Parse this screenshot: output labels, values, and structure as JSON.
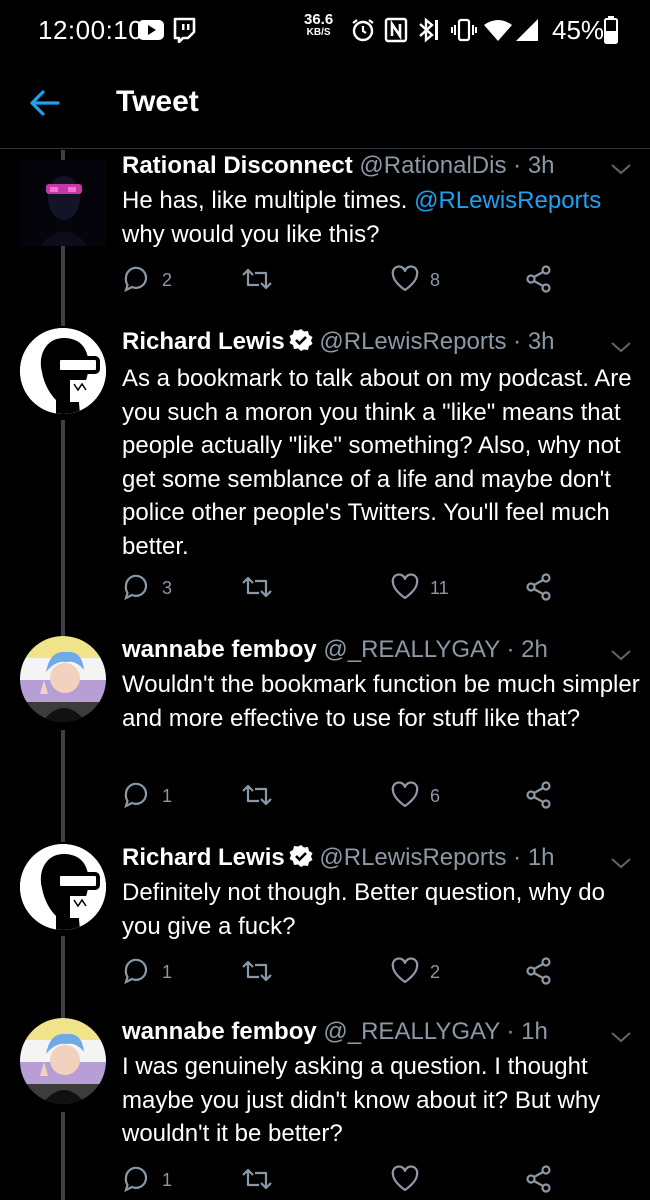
{
  "status_bar": {
    "time": "12:00:10",
    "net_speed": "36.6",
    "net_unit": "KB/S",
    "battery": "45%",
    "icons": [
      "youtube-icon",
      "twitch-icon",
      "alarm-icon",
      "nfc-icon",
      "bluetooth-icon",
      "vibrate-icon",
      "wifi-icon",
      "signal-icon",
      "battery-icon"
    ]
  },
  "header": {
    "title": "Tweet",
    "back_icon": "arrow-left-icon"
  },
  "colors": {
    "accent": "#1da1f2",
    "muted": "#8b98a5",
    "background": "#000000"
  },
  "tweets": [
    {
      "name": "Rational Disconnect",
      "handle": "@RationalDis",
      "time": "3h",
      "verified": false,
      "body_pre": "He has, like multiple times. ",
      "mention": "@RLewisReports",
      "body_post": " why would you like this?",
      "replies": "2",
      "retweets": "",
      "likes": "8"
    },
    {
      "name": "Richard Lewis",
      "handle": "@RLewisReports",
      "time": "3h",
      "verified": true,
      "body": "As a bookmark to talk about on my podcast. Are you such a moron you think a \"like\" means that people actually \"like\" something? Also, why not get some semblance of a life and maybe don't police other people's Twitters. You'll feel much better.",
      "replies": "3",
      "retweets": "",
      "likes": "11"
    },
    {
      "name": "wannabe femboy",
      "handle": "@_REALLYGAY",
      "time": "2h",
      "verified": false,
      "body": "Wouldn't the bookmark function be much simpler and more effective to use for stuff like that?",
      "replies": "1",
      "retweets": "",
      "likes": "6"
    },
    {
      "name": "Richard Lewis",
      "handle": "@RLewisReports",
      "time": "1h",
      "verified": true,
      "body": "Definitely not though. Better question, why do you give a fuck?",
      "replies": "1",
      "retweets": "",
      "likes": "2"
    },
    {
      "name": "wannabe femboy",
      "handle": "@_REALLYGAY",
      "time": "1h",
      "verified": false,
      "body": "I was genuinely asking a question. I thought maybe you just didn't know about it? But why wouldn't it be better?",
      "replies": "1",
      "retweets": "",
      "likes": ""
    }
  ]
}
